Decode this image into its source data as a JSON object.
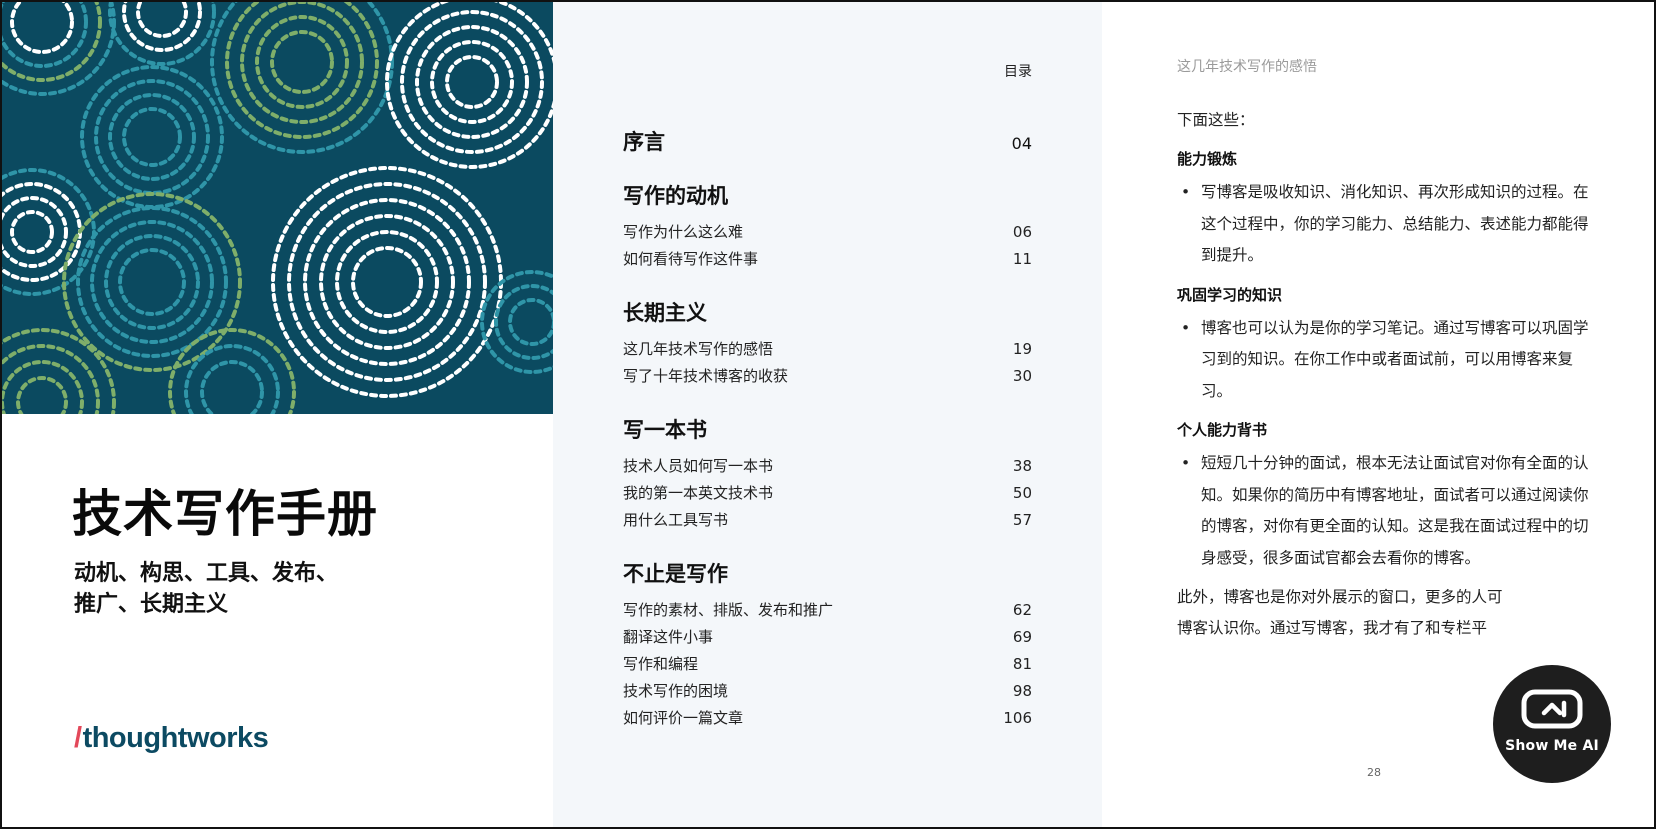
{
  "cover": {
    "title": "技术写作手册",
    "subtitle_line1": "动机、构思、工具、发布、",
    "subtitle_line2": "推广、长期主义",
    "brand": "thoughtworks",
    "colors": {
      "art_background": "#0b4a60",
      "dot_green": "#7fae6a",
      "dot_teal": "#2f95a8",
      "dot_white": "#ffffff",
      "brand": "#0c4a62",
      "brand_slash": "#e3485a"
    }
  },
  "toc": {
    "heading": "目录",
    "sections": [
      {
        "title": "序言",
        "page": "04",
        "entries": []
      },
      {
        "title": "写作的动机",
        "page": "",
        "entries": [
          {
            "title": "写作为什么这么难",
            "page": "06"
          },
          {
            "title": "如何看待写作这件事",
            "page": "11"
          }
        ]
      },
      {
        "title": "长期主义",
        "page": "",
        "entries": [
          {
            "title": "这几年技术写作的感悟",
            "page": "19"
          },
          {
            "title": "写了十年技术博客的收获",
            "page": "30"
          }
        ]
      },
      {
        "title": "写一本书",
        "page": "",
        "entries": [
          {
            "title": "技术人员如何写一本书",
            "page": "38"
          },
          {
            "title": "我的第一本英文技术书",
            "page": "50"
          },
          {
            "title": "用什么工具写书",
            "page": "57"
          }
        ]
      },
      {
        "title": "不止是写作",
        "page": "",
        "entries": [
          {
            "title": "写作的素材、排版、发布和推广",
            "page": "62"
          },
          {
            "title": "翻译这件小事",
            "page": "69"
          },
          {
            "title": "写作和编程",
            "page": "81"
          },
          {
            "title": "技术写作的困境",
            "page": "98"
          },
          {
            "title": "如何评价一篇文章",
            "page": "106"
          }
        ]
      }
    ]
  },
  "article": {
    "running_header": "这几年技术写作的感悟",
    "intro": "下面这些：",
    "heading1": "能力锻炼",
    "bullet1": "写博客是吸收知识、消化知识、再次形成知识的过程。在这个过程中，你的学习能力、总结能力、表述能力都能得到提升。",
    "heading2": "巩固学习的知识",
    "bullet2": "博客也可以认为是你的学习笔记。通过写博客可以巩固学习到的知识。在你工作中或者面试前，可以用博客来复习。",
    "heading3": "个人能力背书",
    "bullet3": "短短几十分钟的面试，根本无法让面试官对你有全面的认知。如果你的简历中有博客地址，面试者可以通过阅读你的博客，对你有更全面的认知。这是我在面试过程中的切身感受，很多面试官都会去看你的博客。",
    "closing_line1": "此外，博客也是你对外展示的窗口，更多的人可",
    "closing_line2": "博客认识你。通过写博客，我才有了和专栏平",
    "page_number": "28"
  },
  "widget": {
    "label": "Show Me AI",
    "icon": "robot-face-icon"
  }
}
